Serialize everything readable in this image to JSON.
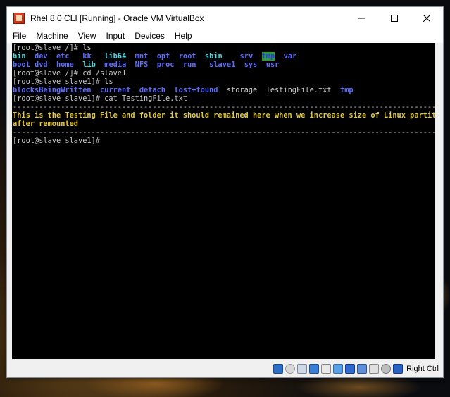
{
  "window": {
    "title": "Rhel 8.0 CLI [Running] - Oracle VM VirtualBox",
    "controls": {
      "minimize": "—",
      "maximize": "☐",
      "close": "✕"
    }
  },
  "menu": [
    "File",
    "Machine",
    "View",
    "Input",
    "Devices",
    "Help"
  ],
  "terminal": {
    "lines": [
      [
        {
          "t": "[root@slave /]# ls",
          "c": "gray"
        }
      ],
      [
        {
          "t": "bin",
          "c": "cyan"
        },
        {
          "t": "  ",
          "c": "gray"
        },
        {
          "t": "dev",
          "c": "blue"
        },
        {
          "t": "  ",
          "c": "gray"
        },
        {
          "t": "etc",
          "c": "blue"
        },
        {
          "t": "   ",
          "c": "gray"
        },
        {
          "t": "kk",
          "c": "blue"
        },
        {
          "t": "   ",
          "c": "gray"
        },
        {
          "t": "lib64",
          "c": "cyan"
        },
        {
          "t": "  ",
          "c": "gray"
        },
        {
          "t": "mnt",
          "c": "blue"
        },
        {
          "t": "  ",
          "c": "gray"
        },
        {
          "t": "opt",
          "c": "blue"
        },
        {
          "t": "  ",
          "c": "gray"
        },
        {
          "t": "root",
          "c": "blue"
        },
        {
          "t": "  ",
          "c": "gray"
        },
        {
          "t": "sbin",
          "c": "cyan"
        },
        {
          "t": "    ",
          "c": "gray"
        },
        {
          "t": "srv",
          "c": "blue"
        },
        {
          "t": "  ",
          "c": "gray"
        },
        {
          "t": "tmp",
          "c": "hl"
        },
        {
          "t": "  ",
          "c": "gray"
        },
        {
          "t": "var",
          "c": "blue"
        }
      ],
      [
        {
          "t": "boot",
          "c": "blue"
        },
        {
          "t": " ",
          "c": "gray"
        },
        {
          "t": "dvd",
          "c": "blue"
        },
        {
          "t": "  ",
          "c": "gray"
        },
        {
          "t": "home",
          "c": "blue"
        },
        {
          "t": "  ",
          "c": "gray"
        },
        {
          "t": "lib",
          "c": "cyan"
        },
        {
          "t": "  ",
          "c": "gray"
        },
        {
          "t": "media",
          "c": "blue"
        },
        {
          "t": "  ",
          "c": "gray"
        },
        {
          "t": "NFS",
          "c": "blue"
        },
        {
          "t": "  ",
          "c": "gray"
        },
        {
          "t": "proc",
          "c": "blue"
        },
        {
          "t": "  ",
          "c": "gray"
        },
        {
          "t": "run",
          "c": "blue"
        },
        {
          "t": "   ",
          "c": "gray"
        },
        {
          "t": "slave1",
          "c": "blue"
        },
        {
          "t": "  ",
          "c": "gray"
        },
        {
          "t": "sys",
          "c": "blue"
        },
        {
          "t": "  ",
          "c": "gray"
        },
        {
          "t": "usr",
          "c": "blue"
        }
      ],
      [
        {
          "t": "[root@slave /]# cd /slave1",
          "c": "gray"
        }
      ],
      [
        {
          "t": "[root@slave slave1]# ls",
          "c": "gray"
        }
      ],
      [
        {
          "t": "blocksBeingWritten",
          "c": "blue"
        },
        {
          "t": "  ",
          "c": "gray"
        },
        {
          "t": "current",
          "c": "blue"
        },
        {
          "t": "  ",
          "c": "gray"
        },
        {
          "t": "detach",
          "c": "blue"
        },
        {
          "t": "  ",
          "c": "gray"
        },
        {
          "t": "lost+found",
          "c": "blue"
        },
        {
          "t": "  storage  TestingFile.txt  ",
          "c": "gray"
        },
        {
          "t": "tmp",
          "c": "blue"
        }
      ],
      [
        {
          "t": "[root@slave slave1]# cat TestingFile.txt",
          "c": "gray"
        }
      ],
      [
        {
          "t": "-------------------------------------------------------------------------------------------------------",
          "c": "gray"
        }
      ],
      [
        {
          "t": "This is the Testing File and folder it should remained here when we increase size of Linux partition",
          "c": "yellow"
        }
      ],
      [
        {
          "t": "after remounted",
          "c": "yellow"
        }
      ],
      [
        {
          "t": "-------------------------------------------------------------------------------------------------------",
          "c": "gray"
        }
      ],
      [
        {
          "t": "[root@slave slave1]#",
          "c": "gray"
        }
      ]
    ]
  },
  "statusbar": {
    "icons": [
      "hard-disk-icon",
      "optical-drive-icon",
      "audio-icon",
      "network-icon",
      "usb-icon",
      "shared-folders-icon",
      "display-icon",
      "video-capture-icon",
      "recording-icon",
      "cpu-icon",
      "mouse-integration-icon",
      "keyboard-capture-icon"
    ],
    "host_key": "Right Ctrl"
  },
  "colors": {
    "terminal_bg": "#000000",
    "dir_blue": "#5e6cff",
    "link_cyan": "#4fd8e0",
    "text_yellow": "#e6c83a",
    "highlight_green": "#2aa02a"
  }
}
